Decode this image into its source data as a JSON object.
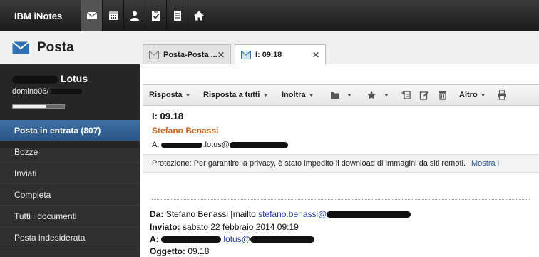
{
  "app": {
    "brand": "IBM iNotes"
  },
  "topnav": {
    "icons": [
      "mail-icon",
      "calendar-icon",
      "contacts-icon",
      "todo-icon",
      "notebook-icon",
      "home-icon"
    ],
    "active": "mail-icon"
  },
  "left": {
    "title": "Posta",
    "user_name": "Lotus",
    "server": "domino06/",
    "quota_fraction": 0.65,
    "nav": [
      {
        "label": "Posta in entrata (807)",
        "selected": true
      },
      {
        "label": "Bozze"
      },
      {
        "label": "Inviati"
      },
      {
        "label": "Completa"
      },
      {
        "label": "Tutti i documenti"
      },
      {
        "label": "Posta indesiderata"
      }
    ]
  },
  "tabs": [
    {
      "label": "Posta-Posta ...",
      "close": "✕"
    },
    {
      "label": "I: 09.18",
      "close": "✕"
    }
  ],
  "toolbar": {
    "reply": "Risposta",
    "reply_all": "Risposta a tutti",
    "forward": "Inoltra",
    "more": "Altro"
  },
  "message": {
    "title": "I: 09.18",
    "sender": "Stefano Benassi",
    "to_prefix": "A:",
    "to_value": ".lotus@",
    "protection_text": "Protezione: Per garantire la privacy, è stato impedito il download di immagini da siti remoti.",
    "protection_link": "Mostra i"
  },
  "forwarded": {
    "from_label": "Da:",
    "from_value": "Stefano Benassi [mailto:",
    "from_link": "stefano.benassi@",
    "sent_label": "Inviato:",
    "sent_value": "sabato 22 febbraio 2014 09:19",
    "to_label": "A:",
    "to_link": ".lotus@",
    "subject_label": "Oggetto:",
    "subject_value": "09.18"
  },
  "colors": {
    "accent": "#2b5787",
    "sender": "#c8621b",
    "link": "#2a3fa0"
  }
}
